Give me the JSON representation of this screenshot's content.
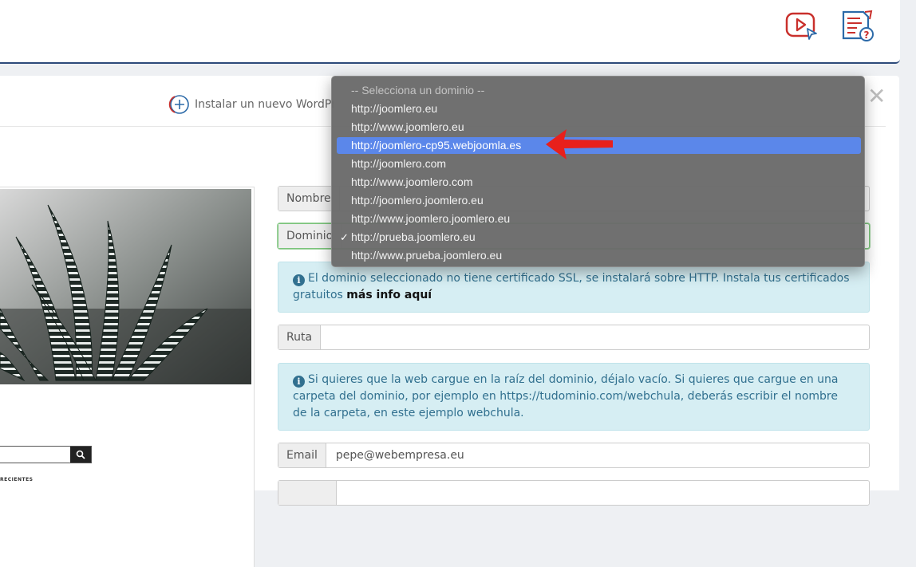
{
  "header": {
    "video_icon": "play-video-icon",
    "help_icon": "document-help-icon"
  },
  "modal": {
    "install_tab_label": "Instalar un nuevo WordPress",
    "close_label": "✕",
    "preview": {
      "recent_label": "RECIENTES"
    },
    "form": {
      "nombre_label": "Nombre",
      "dominio_label": "Dominio",
      "ssl_notice": "El dominio seleccionado no tiene certificado SSL, se instalará sobre HTTP. Instala tus certificados gratuitos",
      "ssl_link": "más info aquí",
      "ruta_label": "Ruta",
      "ruta_value": "",
      "ruta_notice": "Si quieres que la web cargue en la raíz del dominio, déjalo vacío. Si quieres que cargue en una carpeta del dominio, por ejemplo en https://tudominio.com/webchula, deberás escribir el nombre de la carpeta, en este ejemplo webchula.",
      "email_label": "Email",
      "email_value": "pepe@webempresa.eu"
    }
  },
  "dropdown": {
    "options": [
      "-- Selecciona un dominio --",
      "http://joomlero.eu",
      "http://www.joomlero.eu",
      "http://joomlero-cp95.webjoomla.es",
      "http://joomlero.com",
      "http://www.joomlero.com",
      "http://joomlero.joomlero.eu",
      "http://www.joomlero.joomlero.eu",
      "http://prueba.joomlero.eu",
      "http://www.prueba.joomlero.eu"
    ],
    "highlighted_option": "http://joomlero-cp95.webjoomla.es",
    "checked_option": "http://prueba.joomlero.eu",
    "check_mark": "✓"
  },
  "colors": {
    "highlight": "#5b87ea",
    "alert_bg": "#d6eef3",
    "annotation_arrow": "#e8201c",
    "header_border": "#2c4a7a"
  }
}
